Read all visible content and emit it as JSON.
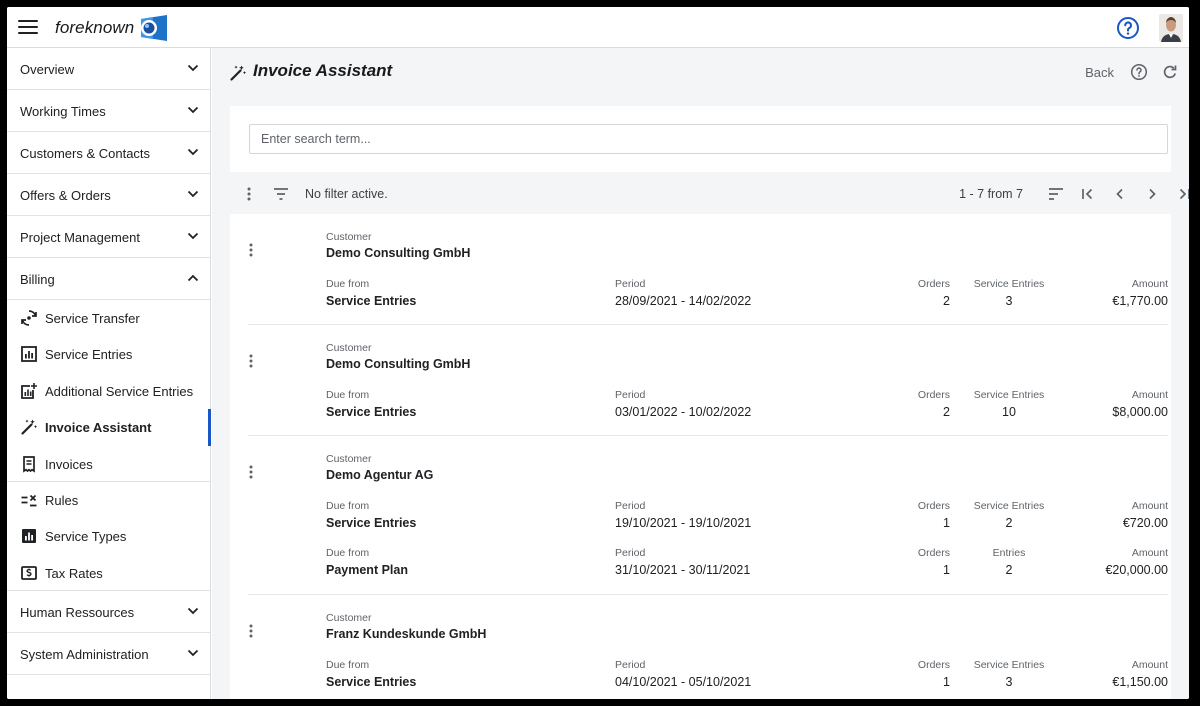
{
  "app": {
    "name": "foreknown",
    "colors": {
      "accent": "#1a56c8",
      "logo_blue": "#1e73c8"
    }
  },
  "sidebar": {
    "groups_top": [
      {
        "label": "Overview",
        "icon": "chevron-down-icon"
      },
      {
        "label": "Working Times",
        "icon": "chevron-down-icon"
      },
      {
        "label": "Customers & Contacts",
        "icon": "chevron-down-icon"
      },
      {
        "label": "Offers & Orders",
        "icon": "chevron-down-icon"
      },
      {
        "label": "Project Management",
        "icon": "chevron-down-icon"
      },
      {
        "label": "Billing",
        "icon": "chevron-up-icon",
        "expanded": true
      }
    ],
    "billing_items": [
      {
        "label": "Service Transfer",
        "icon": "transfer-icon"
      },
      {
        "label": "Service Entries",
        "icon": "bar-chart-icon"
      },
      {
        "label": "Additional Service Entries",
        "icon": "chart-add-icon"
      },
      {
        "label": "Invoice Assistant",
        "icon": "magic-wand-icon",
        "active": true
      },
      {
        "label": "Invoices",
        "icon": "receipt-icon"
      },
      {
        "label": "Rules",
        "icon": "rules-icon"
      },
      {
        "label": "Service Types",
        "icon": "bar-chart-filled-icon"
      },
      {
        "label": "Tax Rates",
        "icon": "money-icon"
      }
    ],
    "groups_bottom": [
      {
        "label": "Human Ressources",
        "icon": "chevron-down-icon"
      },
      {
        "label": "System Administration",
        "icon": "chevron-down-icon"
      }
    ]
  },
  "page": {
    "title": "Invoice Assistant",
    "back_label": "Back"
  },
  "search": {
    "placeholder": "Enter search term..."
  },
  "toolbar": {
    "filter_status": "No filter active.",
    "range": "1 - 7 from 7"
  },
  "entries": [
    {
      "customer_caption": "Customer",
      "customer": "Demo Consulting GmbH",
      "lines": [
        {
          "due_caption": "Due from",
          "due": "Service Entries",
          "period_caption": "Period",
          "period": "28/09/2021 - 14/02/2022",
          "orders_caption": "Orders",
          "orders": "2",
          "count_caption": "Service Entries",
          "count": "3",
          "amount_caption": "Amount",
          "amount": "€1,770.00"
        }
      ]
    },
    {
      "customer_caption": "Customer",
      "customer": "Demo Consulting GmbH",
      "lines": [
        {
          "due_caption": "Due from",
          "due": "Service Entries",
          "period_caption": "Period",
          "period": "03/01/2022 - 10/02/2022",
          "orders_caption": "Orders",
          "orders": "2",
          "count_caption": "Service Entries",
          "count": "10",
          "amount_caption": "Amount",
          "amount": "$8,000.00"
        }
      ]
    },
    {
      "customer_caption": "Customer",
      "customer": "Demo Agentur AG",
      "lines": [
        {
          "due_caption": "Due from",
          "due": "Service Entries",
          "period_caption": "Period",
          "period": "19/10/2021 - 19/10/2021",
          "orders_caption": "Orders",
          "orders": "1",
          "count_caption": "Service Entries",
          "count": "2",
          "amount_caption": "Amount",
          "amount": "€720.00"
        },
        {
          "due_caption": "Due from",
          "due": "Payment Plan",
          "period_caption": "Period",
          "period": "31/10/2021 - 30/11/2021",
          "orders_caption": "Orders",
          "orders": "1",
          "count_caption": "Entries",
          "count": "2",
          "amount_caption": "Amount",
          "amount": "€20,000.00"
        }
      ]
    },
    {
      "customer_caption": "Customer",
      "customer": "Franz Kundeskunde GmbH",
      "lines": [
        {
          "due_caption": "Due from",
          "due": "Service Entries",
          "period_caption": "Period",
          "period": "04/10/2021 - 05/10/2021",
          "orders_caption": "Orders",
          "orders": "1",
          "count_caption": "Service Entries",
          "count": "3",
          "amount_caption": "Amount",
          "amount": "€1,150.00"
        }
      ]
    }
  ]
}
